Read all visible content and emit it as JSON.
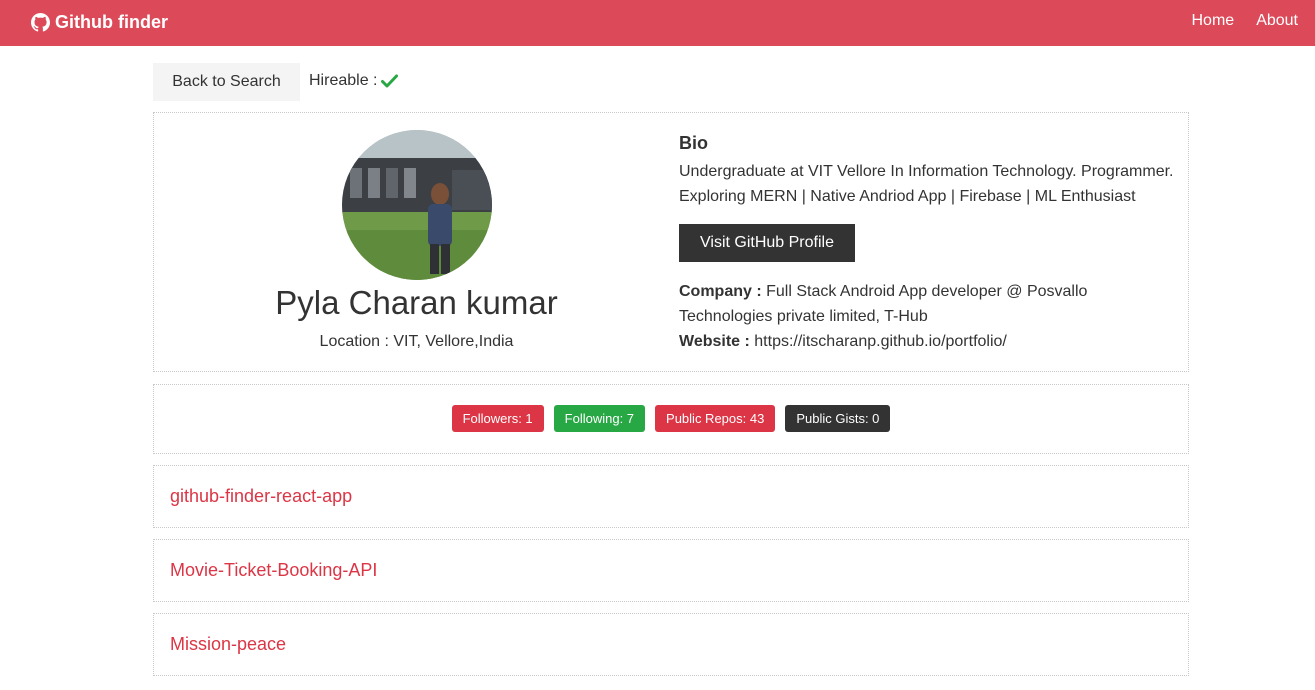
{
  "colors": {
    "navbar": "#dc4a59",
    "accent": "#dc3545",
    "success": "#28a745",
    "dark": "#333333",
    "light": "#f4f4f4"
  },
  "navbar": {
    "brand_icon": "github-icon",
    "brand": "Github finder",
    "links": [
      "Home",
      "About"
    ]
  },
  "controls": {
    "back_label": "Back to Search",
    "hireable_label": "Hireable :",
    "hireable_icon": "check-icon"
  },
  "profile": {
    "avatar_icon": "user-avatar",
    "name": "Pyla Charan kumar",
    "location": "Location : VIT, Vellore,India",
    "bio_title": "Bio",
    "bio": "Undergraduate at VIT Vellore In Information Technology. Programmer. Exploring MERN | Native Andriod App | Firebase | ML Enthusiast",
    "visit_label": "Visit GitHub Profile",
    "company_label": "Company :",
    "company": "Full Stack Android App developer @ Posvallo Technologies private limited, T-Hub",
    "website_label": "Website :",
    "website": "https://itscharanp.github.io/portfolio/"
  },
  "stats": [
    {
      "label": "Followers: 1",
      "color": "#dc3545"
    },
    {
      "label": "Following: 7",
      "color": "#28a745"
    },
    {
      "label": "Public Repos: 43",
      "color": "#dc3545"
    },
    {
      "label": "Public Gists: 0",
      "color": "#333333"
    }
  ],
  "repos": [
    "github-finder-react-app",
    "Movie-Ticket-Booking-API",
    "Mission-peace"
  ]
}
